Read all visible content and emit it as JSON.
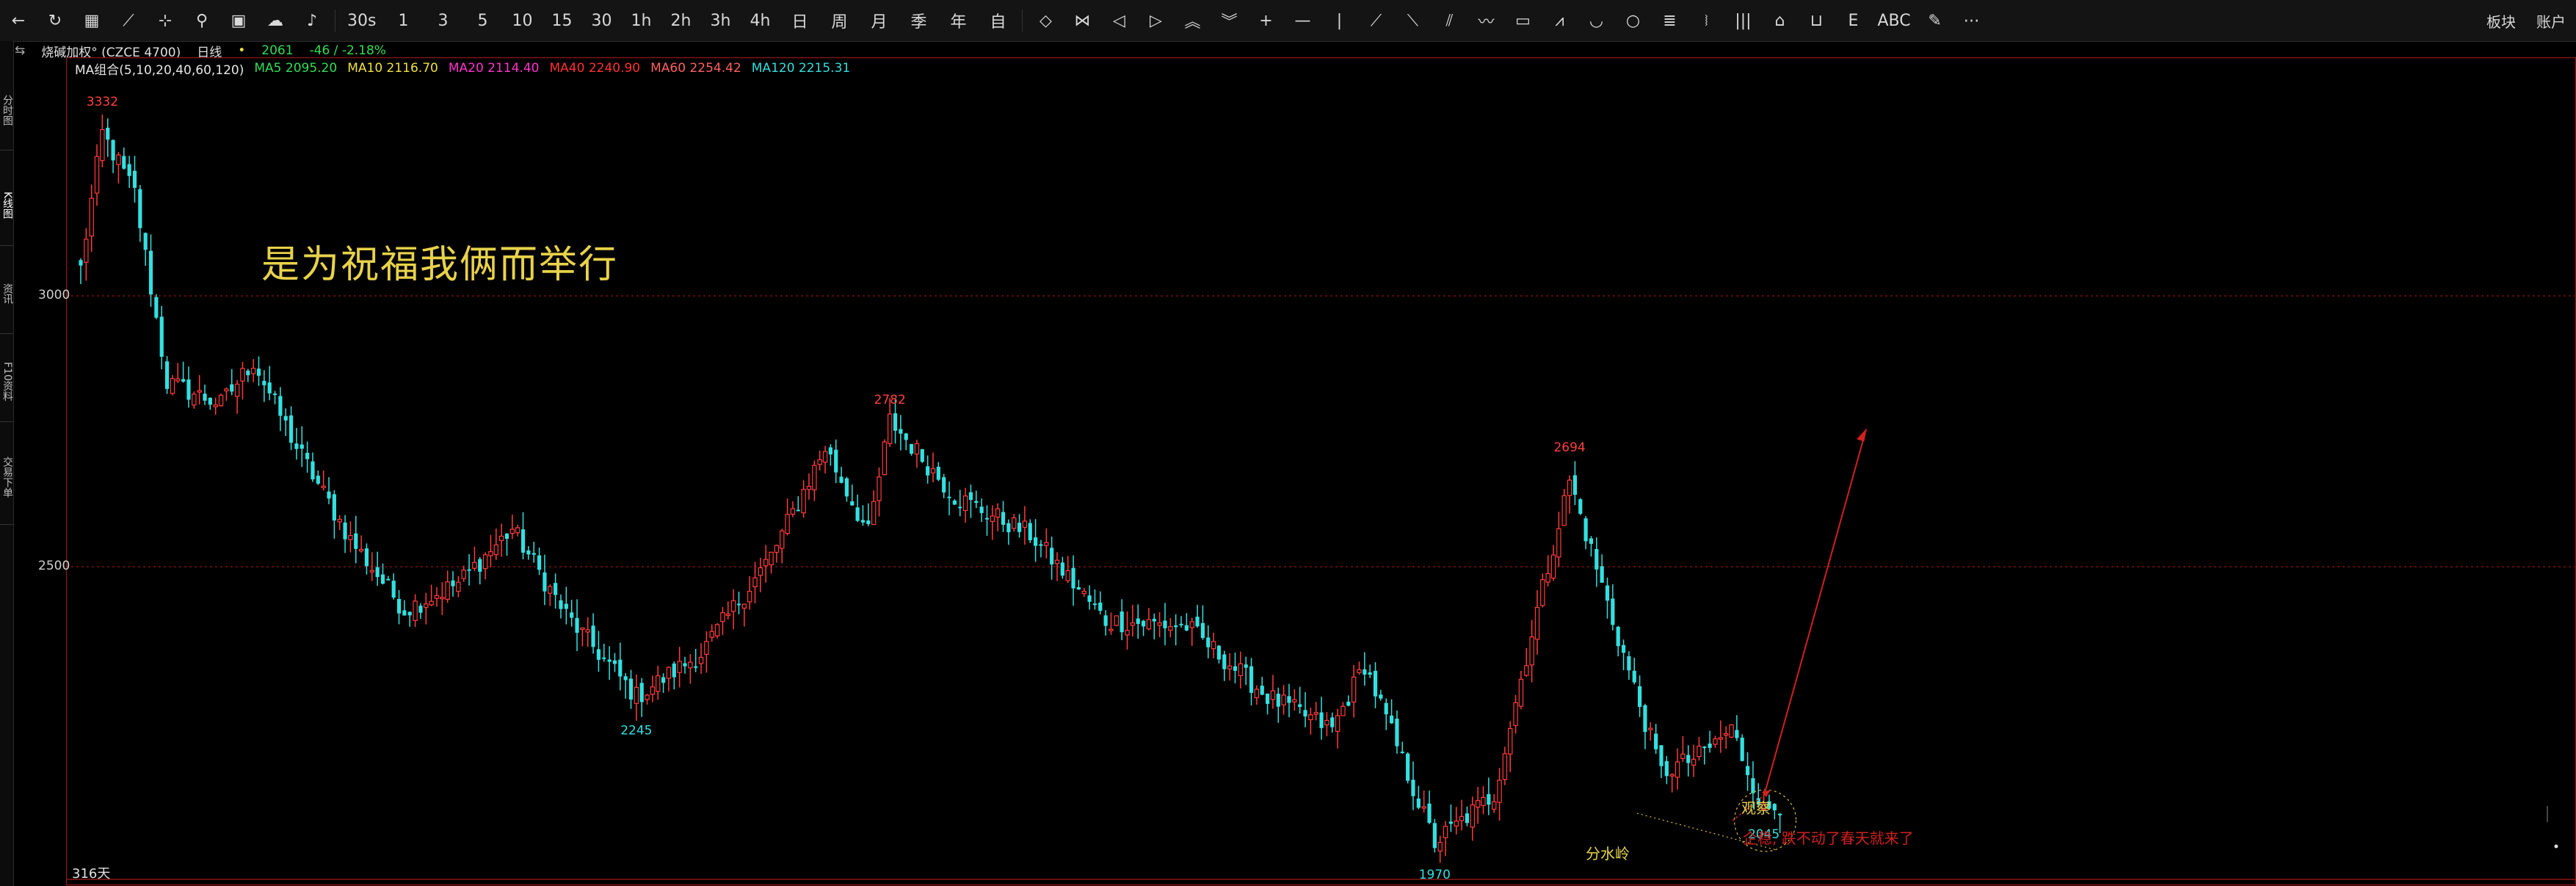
{
  "toolbar": {
    "tools": [
      {
        "name": "back-arrow-icon",
        "glyph": "←"
      },
      {
        "name": "refresh-icon",
        "glyph": "↻"
      },
      {
        "name": "grid-icon",
        "glyph": "▦"
      },
      {
        "name": "line-chart-icon",
        "glyph": "⟋"
      },
      {
        "name": "candle-icon",
        "glyph": "⊹"
      },
      {
        "name": "compare-icon",
        "glyph": "⚲"
      },
      {
        "name": "layout-icon",
        "glyph": "▣"
      },
      {
        "name": "cloud-icon",
        "glyph": "☁"
      },
      {
        "name": "alarm-icon",
        "glyph": "♪"
      }
    ],
    "periods": [
      "30s",
      "1",
      "3",
      "5",
      "10",
      "15",
      "30",
      "1h",
      "2h",
      "3h",
      "4h",
      "日",
      "周",
      "月",
      "季",
      "年",
      "自"
    ],
    "draw_tools": [
      {
        "name": "diamond-icon",
        "glyph": "◇"
      },
      {
        "name": "bowtie-icon",
        "glyph": "⋈"
      },
      {
        "name": "arrow-left-icon",
        "glyph": "◁"
      },
      {
        "name": "arrow-right-icon",
        "glyph": "▷"
      },
      {
        "name": "double-up-icon",
        "glyph": "︽"
      },
      {
        "name": "double-down-icon",
        "glyph": "︾"
      },
      {
        "name": "crosshair-icon",
        "glyph": "+"
      },
      {
        "name": "hline-icon",
        "glyph": "—"
      },
      {
        "name": "vline-icon",
        "glyph": "|"
      },
      {
        "name": "ray-icon",
        "glyph": "⟋"
      },
      {
        "name": "segment-icon",
        "glyph": "⟍"
      },
      {
        "name": "parallel-icon",
        "glyph": "⫽"
      },
      {
        "name": "wave-icon",
        "glyph": "〰"
      },
      {
        "name": "rect-icon",
        "glyph": "▭"
      },
      {
        "name": "zigzag-icon",
        "glyph": "⩘"
      },
      {
        "name": "arc-icon",
        "glyph": "◡"
      },
      {
        "name": "circle-icon",
        "glyph": "○"
      },
      {
        "name": "fib-icon",
        "glyph": "≣"
      },
      {
        "name": "gann-icon",
        "glyph": "⧘"
      },
      {
        "name": "bars-icon",
        "glyph": "|||"
      },
      {
        "name": "house-icon",
        "glyph": "⌂"
      },
      {
        "name": "measure-icon",
        "glyph": "⊔"
      },
      {
        "name": "e-icon",
        "glyph": "E"
      },
      {
        "name": "text-icon",
        "glyph": "ABC"
      },
      {
        "name": "pen-icon",
        "glyph": "✎"
      },
      {
        "name": "more-icon",
        "glyph": "⋯"
      }
    ],
    "right": [
      "板块",
      "账户"
    ]
  },
  "sidebar": {
    "tabs": [
      "分时图",
      "K线图",
      "资讯",
      "F10资料",
      "交易下单"
    ]
  },
  "header": {
    "product": "烧碱加权° (CZCE 4700)",
    "period": "日线",
    "last_price": "2061",
    "change": "-46 / -2.18%"
  },
  "indicators": [
    {
      "label": "MA组合(5,10,20,40,60,120)",
      "color": "#e6e6e6"
    },
    {
      "label": "MA5 2095.20",
      "color": "#33dd55"
    },
    {
      "label": "MA10 2116.70",
      "color": "#f0e040"
    },
    {
      "label": "MA20 2114.40",
      "color": "#ff33cc"
    },
    {
      "label": "MA40 2240.90",
      "color": "#ff3030"
    },
    {
      "label": "MA60 2254.42",
      "color": "#ff6060"
    },
    {
      "label": "MA120 2215.31",
      "color": "#33dddd"
    }
  ],
  "price_labels": {
    "axis": [
      "3000",
      "2500"
    ],
    "high_1": "3332",
    "peak_2": "2782",
    "peak_3": "2694",
    "low_1": "2245",
    "low_2": "1970",
    "last_low": "2045"
  },
  "annotations": {
    "title_text": "是为祝福我俩而举行",
    "watershed": "分水岭",
    "observe": "观察",
    "message": "企稳, 跌不动了春天就来了"
  },
  "day_count": "316天",
  "colors": {
    "up": "#ff3b3b",
    "down": "#33e0e0",
    "grid": "#7a1010",
    "accent": "#e8d24a"
  },
  "chart_data": {
    "type": "candlestick",
    "title": "",
    "ylim": [
      1950,
      3400
    ],
    "key_points": [
      {
        "day": 4,
        "price": 3332,
        "kind": "high"
      },
      {
        "day": 103,
        "price": 2245,
        "kind": "low"
      },
      {
        "day": 150,
        "price": 2782,
        "kind": "high"
      },
      {
        "day": 251,
        "price": 1970,
        "kind": "low"
      },
      {
        "day": 276,
        "price": 2694,
        "kind": "high"
      },
      {
        "day": 312,
        "price": 2045,
        "kind": "low"
      },
      {
        "day": 315,
        "price": 2061,
        "kind": "last"
      }
    ],
    "days": 316
  }
}
